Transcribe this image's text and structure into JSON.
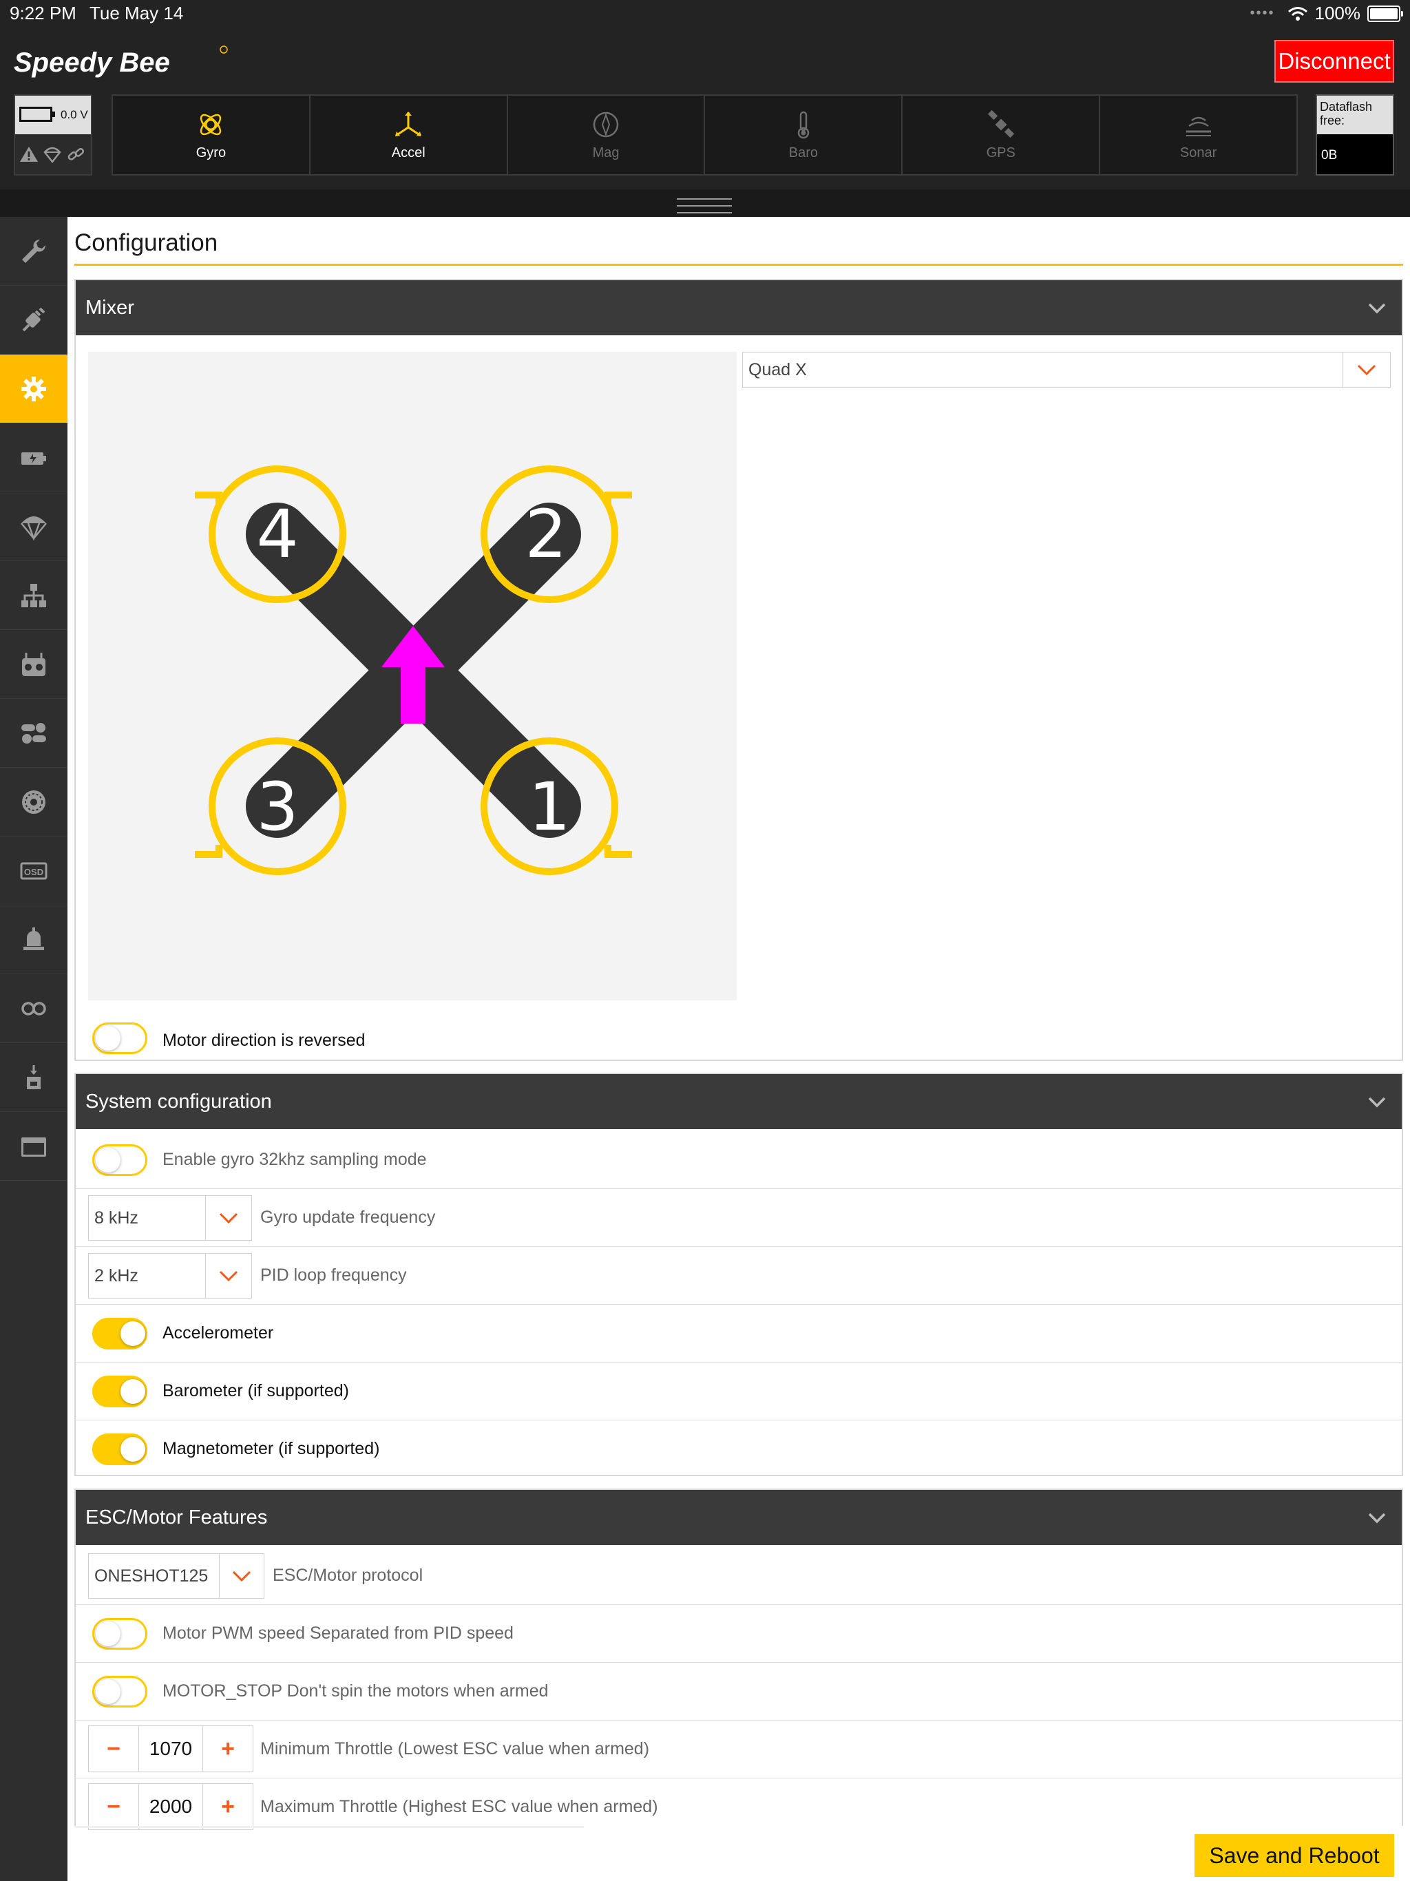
{
  "status": {
    "time": "9:22 PM",
    "date": "Tue May 14",
    "battery": "100%"
  },
  "app": {
    "brand": "Speedy Bee",
    "disconnect_label": "Disconnect"
  },
  "voltage": "0.0 V",
  "sensors": [
    {
      "label": "Gyro",
      "active": true
    },
    {
      "label": "Accel",
      "active": true
    },
    {
      "label": "Mag",
      "active": false
    },
    {
      "label": "Baro",
      "active": false
    },
    {
      "label": "GPS",
      "active": false
    },
    {
      "label": "Sonar",
      "active": false
    }
  ],
  "dataflash": {
    "label": "Dataflash free:",
    "value": "0B"
  },
  "page": {
    "title": "Configuration"
  },
  "mixer": {
    "title": "Mixer",
    "selected": "Quad X",
    "motor_labels": [
      "4",
      "2",
      "3",
      "1"
    ],
    "reversed_label": "Motor direction is reversed",
    "reversed": false
  },
  "system": {
    "title": "System configuration",
    "gyro32_label": "Enable gyro 32khz sampling mode",
    "gyro32": false,
    "gyro_freq": "8 kHz",
    "gyro_freq_label": "Gyro update frequency",
    "pid_freq": "2 kHz",
    "pid_freq_label": "PID loop frequency",
    "accel_label": "Accelerometer",
    "accel": true,
    "baro_label": "Barometer (if supported)",
    "baro": true,
    "mag_label": "Magnetometer (if supported)",
    "mag": true
  },
  "esc": {
    "title": "ESC/Motor Features",
    "protocol": "ONESHOT125",
    "protocol_label": "ESC/Motor protocol",
    "pwm_label": "Motor PWM speed Separated from PID speed",
    "pwm": false,
    "motorstop_label": "MOTOR_STOP Don't spin the motors when armed",
    "motorstop": false,
    "min_throttle": "1070",
    "min_label": "Minimum Throttle (Lowest ESC value when armed)",
    "max_throttle": "2000",
    "max_label": "Maximum Throttle (Highest ESC value when armed)",
    "minus": "−",
    "plus": "+"
  },
  "save_label": "Save and Reboot",
  "colors": {
    "accent": "#ffbb00",
    "disconnect": "#ff0000",
    "arrow": "#ff00ff",
    "chevron": "#f05a1a"
  }
}
